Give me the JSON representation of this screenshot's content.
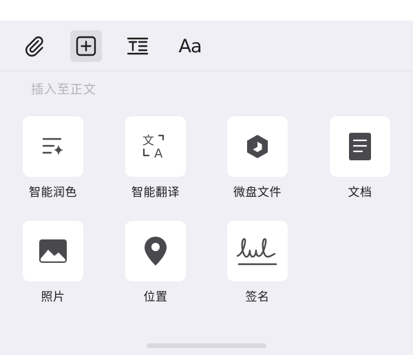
{
  "toolbar": {
    "items": [
      {
        "name": "attachment",
        "icon": "paperclip-icon",
        "active": false
      },
      {
        "name": "insert",
        "icon": "plus-square-icon",
        "active": true
      },
      {
        "name": "text-format",
        "icon": "text-style-icon",
        "active": false
      },
      {
        "name": "font",
        "label": "Aa",
        "active": false
      }
    ]
  },
  "section": {
    "title": "插入至正文"
  },
  "grid": {
    "items": [
      {
        "label": "智能润色",
        "icon": "ai-polish-icon"
      },
      {
        "label": "智能翻译",
        "icon": "translate-icon"
      },
      {
        "label": "微盘文件",
        "icon": "weidisk-icon"
      },
      {
        "label": "文档",
        "icon": "document-icon"
      },
      {
        "label": "照片",
        "icon": "photo-icon"
      },
      {
        "label": "位置",
        "icon": "location-pin-icon"
      },
      {
        "label": "签名",
        "icon": "signature-icon"
      }
    ]
  },
  "colors": {
    "panel_bg": "#efeff5",
    "tile_bg": "#ffffff",
    "icon": "#4a4a4e",
    "label_muted": "#b3b3b9",
    "text": "#1e1e1e"
  }
}
